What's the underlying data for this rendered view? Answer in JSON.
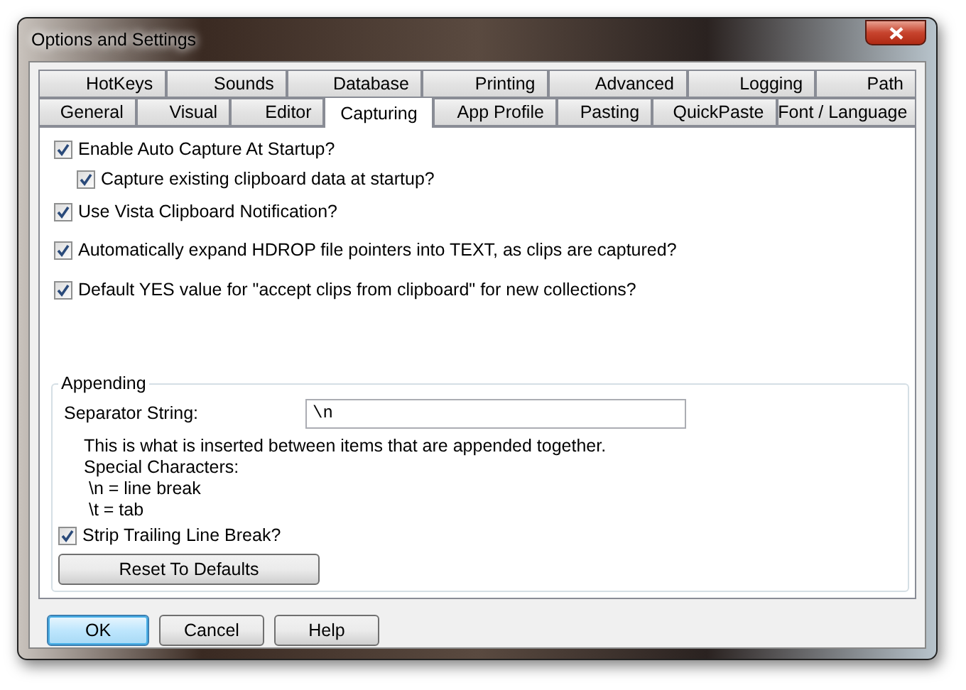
{
  "window": {
    "title": "Options and Settings"
  },
  "tab_rows": [
    [
      {
        "label": "HotKeys",
        "selected": false
      },
      {
        "label": "Sounds",
        "selected": false
      },
      {
        "label": "Database",
        "selected": false
      },
      {
        "label": "Printing",
        "selected": false
      },
      {
        "label": "Advanced",
        "selected": false
      },
      {
        "label": "Logging",
        "selected": false
      },
      {
        "label": "Path",
        "selected": false
      }
    ],
    [
      {
        "label": "General",
        "selected": false
      },
      {
        "label": "Visual",
        "selected": false
      },
      {
        "label": "Editor",
        "selected": false
      },
      {
        "label": "Capturing",
        "selected": true
      },
      {
        "label": "App Profile",
        "selected": false
      },
      {
        "label": "Pasting",
        "selected": false
      },
      {
        "label": "QuickPaste",
        "selected": false
      },
      {
        "label": "Font / Language",
        "selected": false
      }
    ]
  ],
  "options": [
    {
      "label": "Enable Auto Capture At Startup?",
      "checked": true,
      "children": [
        {
          "label": "Capture existing clipboard data at startup?",
          "checked": true
        }
      ]
    },
    {
      "label": "Use Vista Clipboard Notification?",
      "checked": true
    },
    {
      "label": "Automatically expand HDROP file pointers into TEXT, as clips are captured?",
      "checked": true
    },
    {
      "label": "Default YES value for \"accept clips from clipboard\" for new collections?",
      "checked": true
    }
  ],
  "appending": {
    "title": "Appending",
    "separator_label": "Separator String:",
    "separator_value": "\\n",
    "help_lines": [
      "This is what is inserted between items that are appended together.",
      "Special Characters:",
      " \\n = line break",
      " \\t = tab"
    ],
    "strip": {
      "label": "Strip Trailing Line Break?",
      "checked": true
    },
    "reset_button": "Reset To Defaults"
  },
  "buttons": [
    {
      "label": "OK",
      "default": true
    },
    {
      "label": "Cancel",
      "default": false
    },
    {
      "label": "Help",
      "default": false
    }
  ]
}
